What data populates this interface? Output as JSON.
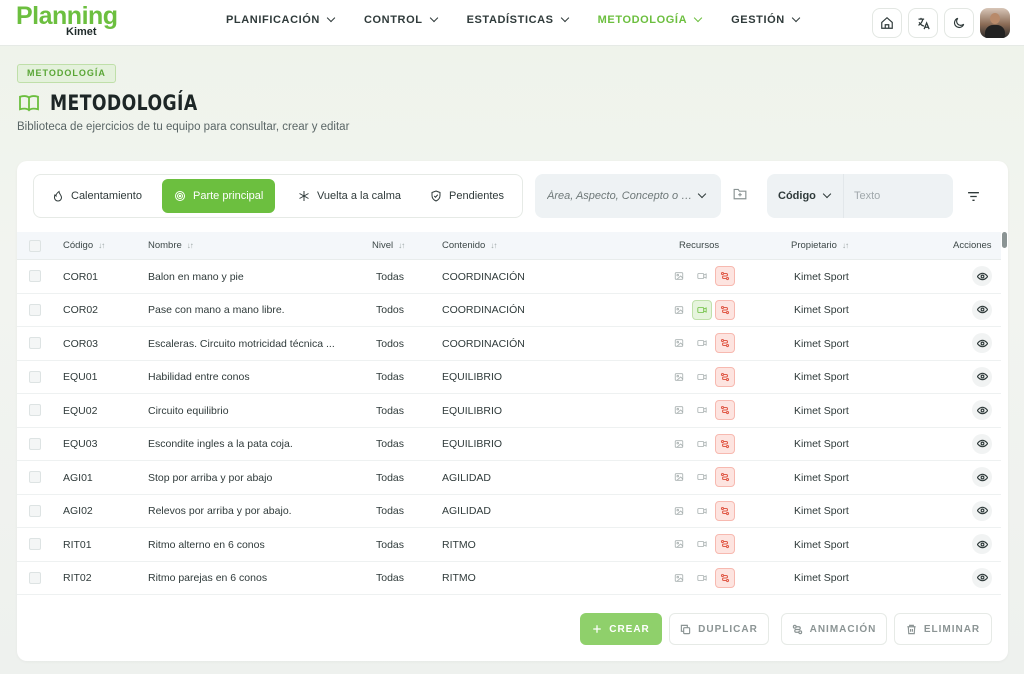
{
  "logo": {
    "main": "Planning",
    "sub": "Kimet"
  },
  "nav": [
    {
      "label": "PLANIFICACIÓN",
      "active": false
    },
    {
      "label": "CONTROL",
      "active": false
    },
    {
      "label": "ESTADÍSTICAS",
      "active": false
    },
    {
      "label": "METODOLOGÍA",
      "active": true
    },
    {
      "label": "GESTIÓN",
      "active": false
    }
  ],
  "top_icons": [
    "home-icon",
    "translate-icon",
    "moon-icon",
    "avatar"
  ],
  "breadcrumb": "METODOLOGÍA",
  "page": {
    "title": "METODOLOGÍA",
    "subtitle": "Biblioteca de ejercicios de tu equipo para consultar, crear y editar"
  },
  "tabs": [
    {
      "label": "Calentamiento",
      "icon": "flame-icon",
      "active": false
    },
    {
      "label": "Parte principal",
      "icon": "target-icon",
      "active": true
    },
    {
      "label": "Vuelta a la calma",
      "icon": "snowflake-icon",
      "active": false
    },
    {
      "label": "Pendientes",
      "icon": "shield-icon",
      "active": false
    }
  ],
  "filters": {
    "area_placeholder": "Área, Aspecto, Concepto o Co...",
    "code_select": "Código",
    "text_placeholder": "Texto"
  },
  "table": {
    "headers": {
      "code": "Código",
      "name": "Nombre",
      "level": "Nivel",
      "content": "Contenido",
      "resources": "Recursos",
      "owner": "Propietario",
      "actions": "Acciones"
    },
    "rows": [
      {
        "code": "COR01",
        "name": "Balon en mano y pie",
        "level": "Todas",
        "content": "COORDINACIÓN",
        "video": false,
        "owner": "Kimet Sport"
      },
      {
        "code": "COR02",
        "name": "Pase con mano a mano libre.",
        "level": "Todos",
        "content": "COORDINACIÓN",
        "video": true,
        "owner": "Kimet Sport"
      },
      {
        "code": "COR03",
        "name": "Escaleras. Circuito motricidad técnica ...",
        "level": "Todos",
        "content": "COORDINACIÓN",
        "video": false,
        "owner": "Kimet Sport"
      },
      {
        "code": "EQU01",
        "name": "Habilidad entre conos",
        "level": "Todas",
        "content": "EQUILIBRIO",
        "video": false,
        "owner": "Kimet Sport"
      },
      {
        "code": "EQU02",
        "name": "Circuito equilibrio",
        "level": "Todas",
        "content": "EQUILIBRIO",
        "video": false,
        "owner": "Kimet Sport"
      },
      {
        "code": "EQU03",
        "name": "Escondite ingles a la pata coja.",
        "level": "Todas",
        "content": "EQUILIBRIO",
        "video": false,
        "owner": "Kimet Sport"
      },
      {
        "code": "AGI01",
        "name": "Stop por arriba y por abajo",
        "level": "Todas",
        "content": "AGILIDAD",
        "video": false,
        "owner": "Kimet Sport"
      },
      {
        "code": "AGI02",
        "name": "Relevos por arriba y por abajo.",
        "level": "Todas",
        "content": "AGILIDAD",
        "video": false,
        "owner": "Kimet Sport"
      },
      {
        "code": "RIT01",
        "name": "Ritmo alterno en 6 conos",
        "level": "Todas",
        "content": "RITMO",
        "video": false,
        "owner": "Kimet Sport"
      },
      {
        "code": "RIT02",
        "name": "Ritmo parejas en 6 conos",
        "level": "Todas",
        "content": "RITMO",
        "video": false,
        "owner": "Kimet Sport"
      }
    ]
  },
  "footer": {
    "create": "CREAR",
    "duplicate": "DUPLICAR",
    "animation": "ANIMACIÓN",
    "delete": "ELIMINAR"
  },
  "colors": {
    "brand_green": "#6cbf3f",
    "create_button": "#8fd06b",
    "animation_badge": "#fde4e0"
  }
}
